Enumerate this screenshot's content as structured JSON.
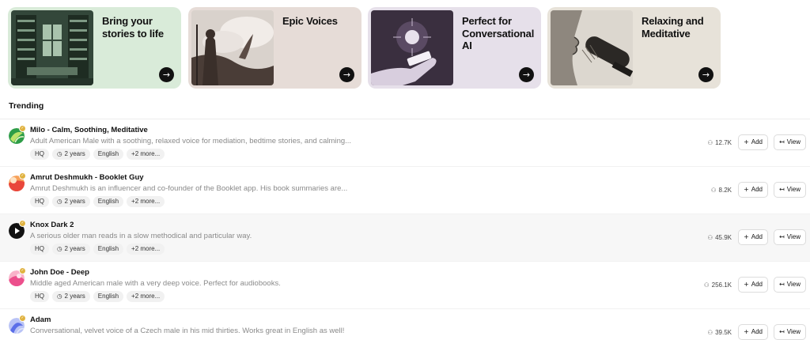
{
  "cards": [
    {
      "title": "Bring your stories to life",
      "bg": "#d9ebd9"
    },
    {
      "title": "Epic Voices",
      "bg": "#e6dcd7"
    },
    {
      "title": "Perfect for Conversational AI",
      "bg": "#e6e0ea"
    },
    {
      "title": "Relaxing and Meditative",
      "bg": "#e7e2d9"
    }
  ],
  "card_arrow": "→",
  "section_title": "Trending",
  "add_label": "Add",
  "view_label": "View",
  "tag_icons": {
    "clock": "◷",
    "person": "⚇",
    "plus": "+",
    "view": "↤"
  },
  "voices": [
    {
      "name": "Milo - Calm, Soothing, Meditative",
      "description": "Adult American Male with a soothing, relaxed voice for mediation, bedtime stories, and calming...",
      "tags": [
        "HQ",
        "2 years",
        "English",
        "+2 more..."
      ],
      "uses": "12.7K",
      "avatar_colors": [
        "#2e9d48",
        "#bde26a"
      ]
    },
    {
      "name": "Amrut Deshmukh - Booklet Guy",
      "description": "Amrut Deshmukh is an influencer and co-founder of the Booklet app. His book summaries are...",
      "tags": [
        "HQ",
        "2 years",
        "English",
        "+2 more..."
      ],
      "uses": "8.2K",
      "avatar_colors": [
        "#e9473b",
        "#f7a15a"
      ]
    },
    {
      "name": "Knox Dark 2",
      "description": "A serious older man reads in a slow methodical and particular way.",
      "tags": [
        "HQ",
        "2 years",
        "English",
        "+2 more..."
      ],
      "uses": "45.9K",
      "avatar_colors": [
        "#111111",
        "#111111"
      ]
    },
    {
      "name": "John Doe - Deep",
      "description": "Middle aged American male with a very deep voice. Perfect for audiobooks.",
      "tags": [
        "HQ",
        "2 years",
        "English",
        "+2 more..."
      ],
      "uses": "256.1K",
      "avatar_colors": [
        "#ec4f8c",
        "#f9b2c9"
      ]
    },
    {
      "name": "Adam",
      "description": "Conversational, velvet voice of a Czech male in his mid thirties. Works great in English as well!",
      "tags": [],
      "uses": "39.5K",
      "avatar_colors": [
        "#5b6ee8",
        "#b9c3f6"
      ]
    }
  ]
}
